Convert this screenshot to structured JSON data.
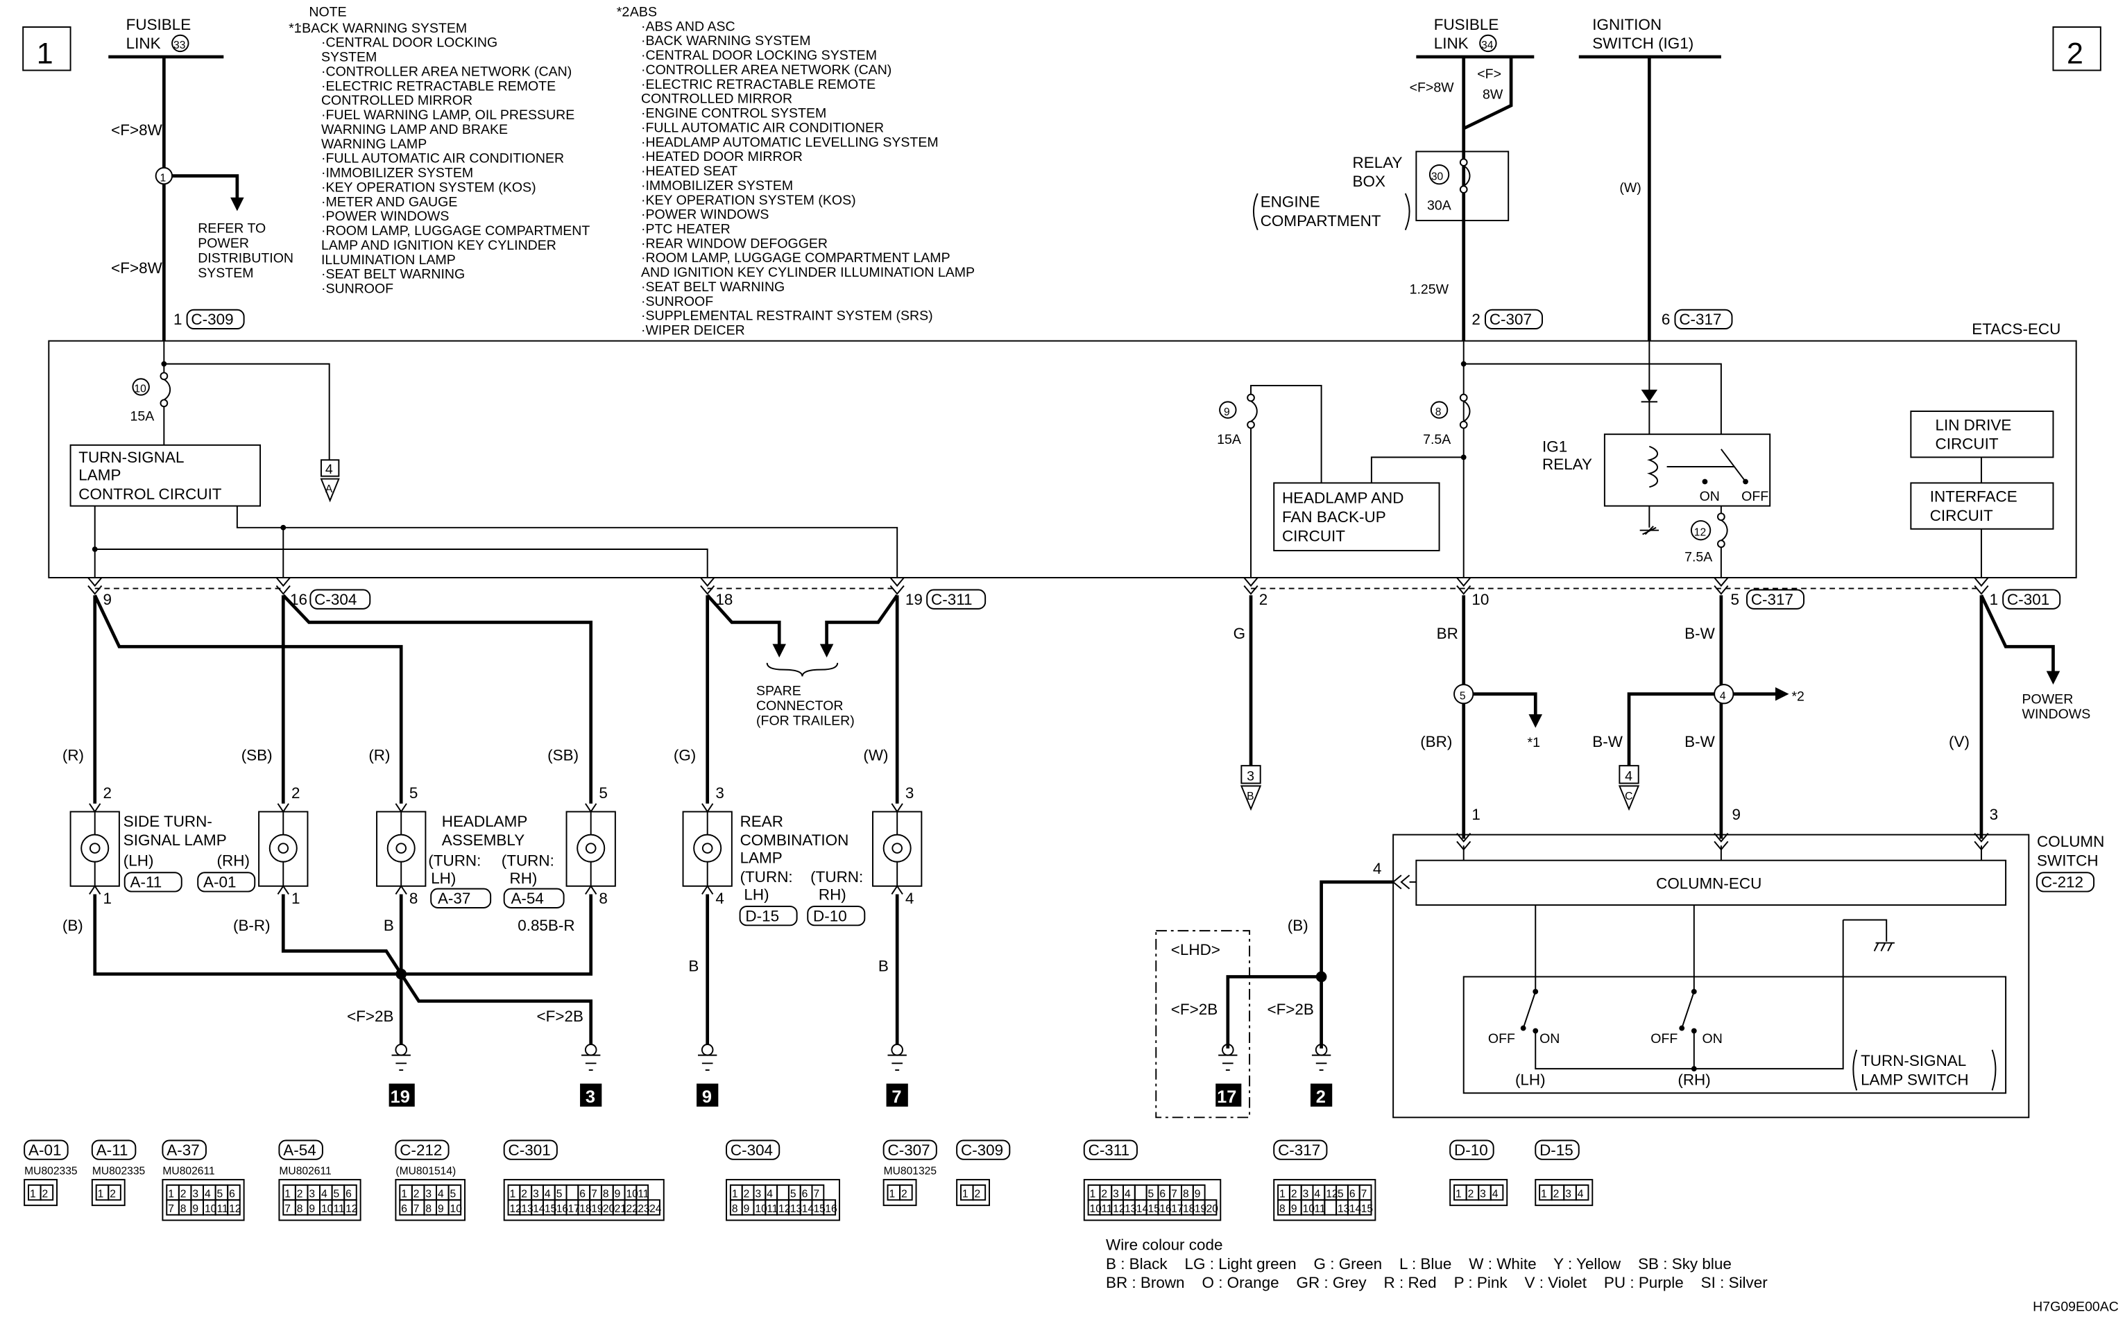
{
  "page_markers": [
    "1",
    "2"
  ],
  "fusible_link_33": {
    "l1": "FUSIBLE",
    "l2": "LINK",
    "num": "33",
    "w1": "<F>8W",
    "w2": "<F>8W",
    "junction": "1"
  },
  "refer": [
    "REFER TO",
    "POWER",
    "DISTRIBUTION",
    "SYSTEM"
  ],
  "note": {
    "title": "NOTE",
    "mark1": "*1",
    "lines1": [
      ":BACK WARNING SYSTEM",
      "·CENTRAL DOOR LOCKING",
      "SYSTEM",
      "·CONTROLLER AREA NETWORK (CAN)",
      "·ELECTRIC RETRACTABLE REMOTE",
      "CONTROLLED MIRROR",
      "·FUEL WARNING LAMP, OIL PRESSURE",
      "WARNING LAMP AND BRAKE",
      "WARNING LAMP",
      "·FULL AUTOMATIC AIR CONDITIONER",
      "·IMMOBILIZER SYSTEM",
      "·KEY OPERATION SYSTEM (KOS)",
      "·METER AND GAUGE",
      "·POWER WINDOWS",
      "·ROOM LAMP, LUGGAGE COMPARTMENT",
      "LAMP AND IGNITION KEY CYLINDER",
      "ILLUMINATION LAMP",
      "·SEAT BELT WARNING",
      "·SUNROOF"
    ],
    "mark2": "*2",
    "lines2": [
      ":ABS",
      "·ABS AND ASC",
      "·BACK WARNING SYSTEM",
      "·CENTRAL DOOR LOCKING SYSTEM",
      "·CONTROLLER AREA NETWORK (CAN)",
      "·ELECTRIC RETRACTABLE REMOTE",
      "CONTROLLED MIRROR",
      "·ENGINE CONTROL SYSTEM",
      "·FULL AUTOMATIC AIR CONDITIONER",
      "·HEADLAMP AUTOMATIC LEVELLING SYSTEM",
      "·HEATED DOOR MIRROR",
      "·HEATED SEAT",
      "·IMMOBILIZER SYSTEM",
      "·KEY OPERATION SYSTEM (KOS)",
      "·POWER WINDOWS",
      "·PTC HEATER",
      "·REAR WINDOW DEFOGGER",
      "·ROOM LAMP, LUGGAGE COMPARTMENT LAMP",
      "AND IGNITION KEY CYLINDER ILLUMINATION LAMP",
      "·SEAT BELT WARNING",
      "·SUNROOF",
      "·SUPPLEMENTAL RESTRAINT SYSTEM (SRS)",
      "·WIPER DEICER"
    ]
  },
  "fusible_link_34": {
    "l1": "FUSIBLE",
    "l2": "LINK",
    "num": "34",
    "w1": "<F>8W",
    "w2a": "<F>",
    "w2b": "8W"
  },
  "relay_box": {
    "l1": "RELAY",
    "l2": "BOX",
    "fuse": "30",
    "amp": "30A",
    "loc1": "ENGINE",
    "loc2": "COMPARTMENT",
    "wire": "1.25W"
  },
  "ignition": {
    "l1": "IGNITION",
    "l2": "SWITCH (IG1)",
    "wire": "(W)"
  },
  "ecu": {
    "title": "ETACS-ECU",
    "in_pins": [
      {
        "pin": "1",
        "conn": "C-309"
      },
      {
        "pin": "2",
        "conn": "C-307"
      },
      {
        "pin": "6",
        "conn": "C-317"
      }
    ],
    "fuse10": {
      "num": "10",
      "amp": "15A"
    },
    "fuse9": {
      "num": "9",
      "amp": "15A"
    },
    "fuse8": {
      "num": "8",
      "amp": "7.5A"
    },
    "fuse12": {
      "num": "12",
      "amp": "7.5A"
    },
    "turn_circuit": [
      "TURN-SIGNAL",
      "LAMP",
      "CONTROL CIRCUIT"
    ],
    "conn4": {
      "num": "4",
      "letter": "A"
    },
    "headlamp_circuit": [
      "HEADLAMP AND",
      "FAN BACK-UP",
      "CIRCUIT"
    ],
    "ig1": {
      "l1": "IG1",
      "l2": "RELAY",
      "on": "ON",
      "off": "OFF"
    },
    "lin": [
      "LIN DRIVE",
      "CIRCUIT"
    ],
    "interface": [
      "INTERFACE",
      "CIRCUIT"
    ],
    "out_pins": [
      {
        "pin": "9"
      },
      {
        "pin": "16",
        "conn": "C-304"
      },
      {
        "pin": "18"
      },
      {
        "pin": "19",
        "conn": "C-311"
      },
      {
        "pin": "2"
      },
      {
        "pin": "10"
      },
      {
        "pin": "5",
        "conn": "C-317"
      },
      {
        "pin": "1",
        "conn": "C-301"
      }
    ]
  },
  "spare": [
    "SPARE",
    "CONNECTOR",
    "(FOR TRAILER)"
  ],
  "wires": {
    "r1": "(R)",
    "sb1": "(SB)",
    "r2": "(R)",
    "sb2": "(SB)",
    "g1": "(G)",
    "w1": "(W)",
    "b1": "(B)",
    "br1": "(B-R)",
    "b2": "B",
    "br2": "0.85B-R",
    "b3": "B",
    "b4": "B",
    "g": "G",
    "br": "BR",
    "bw1": "B-W",
    "brp": "(BR)",
    "bw2": "B-W",
    "bw3": "B-W",
    "v": "(V)",
    "b5": "(B)",
    "f2b": "<F>2B"
  },
  "lamps": {
    "side": {
      "l1": "SIDE TURN-",
      "l2": "SIGNAL LAMP",
      "lh": "(LH)",
      "rh": "(RH)",
      "c_lh": "A-11",
      "c_rh": "A-01",
      "pins": [
        "2",
        "2",
        "1",
        "1"
      ]
    },
    "head": {
      "l1": "HEADLAMP",
      "l2": "ASSEMBLY",
      "lh1": "(TURN:",
      "lh2": "LH)",
      "rh1": "(TURN:",
      "rh2": "RH)",
      "c_lh": "A-37",
      "c_rh": "A-54",
      "pins": [
        "5",
        "5",
        "8",
        "8"
      ]
    },
    "rear": {
      "l1": "REAR",
      "l2": "COMBINATION",
      "l3": "LAMP",
      "lh1": "(TURN:",
      "lh2": "LH)",
      "rh1": "(TURN:",
      "rh2": "RH)",
      "c_lh": "D-15",
      "c_rh": "D-10",
      "pins": [
        "3",
        "3",
        "4",
        "4"
      ]
    }
  },
  "grounds": [
    "19",
    "3",
    "9",
    "7",
    "17",
    "2"
  ],
  "junctions": {
    "j5": "5",
    "j4": "4",
    "ref1": "*1",
    "ref2": "*2",
    "conn3": {
      "num": "3",
      "letter": "B"
    },
    "conn4": {
      "num": "4",
      "letter": "C"
    },
    "pw1": "POWER",
    "pw2": "WINDOWS"
  },
  "column_switch": {
    "l1": "COLUMN",
    "l2": "SWITCH",
    "conn": "C-212",
    "ecu": "COLUMN-ECU",
    "pins": [
      "1",
      "9",
      "3",
      "4"
    ],
    "lhd": "<LHD>",
    "off": "OFF",
    "on": "ON",
    "lh": "(LH)",
    "rh": "(RH)",
    "sw1": "TURN-SIGNAL",
    "sw2": "LAMP SWITCH"
  },
  "connector_views": [
    {
      "id": "A-01",
      "part": "MU802335",
      "rows": [
        [
          "1",
          "2"
        ]
      ]
    },
    {
      "id": "A-11",
      "part": "MU802335",
      "rows": [
        [
          "1",
          "2"
        ]
      ]
    },
    {
      "id": "A-37",
      "part": "MU802611",
      "rows": [
        [
          "1",
          "2",
          "3",
          "4",
          "5",
          "6"
        ],
        [
          "7",
          "8",
          "9",
          "10",
          "11",
          "12"
        ]
      ]
    },
    {
      "id": "A-54",
      "part": "MU802611",
      "rows": [
        [
          "1",
          "2",
          "3",
          "4",
          "5",
          "6"
        ],
        [
          "7",
          "8",
          "9",
          "10",
          "11",
          "12"
        ]
      ]
    },
    {
      "id": "C-212",
      "part": "(MU801514)",
      "rows": [
        [
          "1",
          "2",
          "3",
          "4",
          "5"
        ],
        [
          "6",
          "7",
          "8",
          "9",
          "10"
        ]
      ]
    },
    {
      "id": "C-301",
      "part": "",
      "rows": [
        [
          "1",
          "2",
          "3",
          "4",
          "5",
          "",
          "6",
          "7",
          "8",
          "9",
          "10",
          "11"
        ],
        [
          "12",
          "13",
          "14",
          "15",
          "16",
          "17",
          "18",
          "19",
          "20",
          "21",
          "22",
          "23",
          "24"
        ]
      ]
    },
    {
      "id": "C-304",
      "part": "",
      "rows": [
        [
          "1",
          "2",
          "3",
          "4",
          "",
          "5",
          "6",
          "7"
        ],
        [
          "8",
          "9",
          "10",
          "11",
          "12",
          "13",
          "14",
          "15",
          "16"
        ]
      ]
    },
    {
      "id": "C-307",
      "part": "MU801325",
      "rows": [
        [
          "1",
          "2"
        ]
      ]
    },
    {
      "id": "C-309",
      "part": "",
      "rows": [
        [
          "1",
          "2"
        ]
      ]
    },
    {
      "id": "C-311",
      "part": "",
      "rows": [
        [
          "1",
          "2",
          "3",
          "4",
          "",
          "5",
          "6",
          "7",
          "8",
          "9"
        ],
        [
          "10",
          "11",
          "12",
          "13",
          "14",
          "15",
          "16",
          "17",
          "18",
          "19",
          "20"
        ]
      ]
    },
    {
      "id": "C-317",
      "part": "",
      "rows": [
        [
          "1",
          "2",
          "3",
          "4",
          "12",
          "5",
          "6",
          "7"
        ],
        [
          "8",
          "9",
          "10",
          "11",
          "",
          "13",
          "14",
          "15"
        ]
      ]
    },
    {
      "id": "D-10",
      "part": "",
      "rows": [
        [
          "1",
          "2",
          "3",
          "4"
        ]
      ]
    },
    {
      "id": "D-15",
      "part": "",
      "rows": [
        [
          "1",
          "2",
          "3",
          "4"
        ]
      ]
    }
  ],
  "colour_code": {
    "title": "Wire colour code",
    "row1": "B : Black    LG : Light green    G : Green    L : Blue    W : White    Y : Yellow    SB : Sky blue",
    "row2": "BR : Brown    O : Orange    GR : Grey    R : Red    P : Pink    V : Violet    PU : Purple    SI : Silver"
  },
  "figure_code": "H7G09E00AC"
}
